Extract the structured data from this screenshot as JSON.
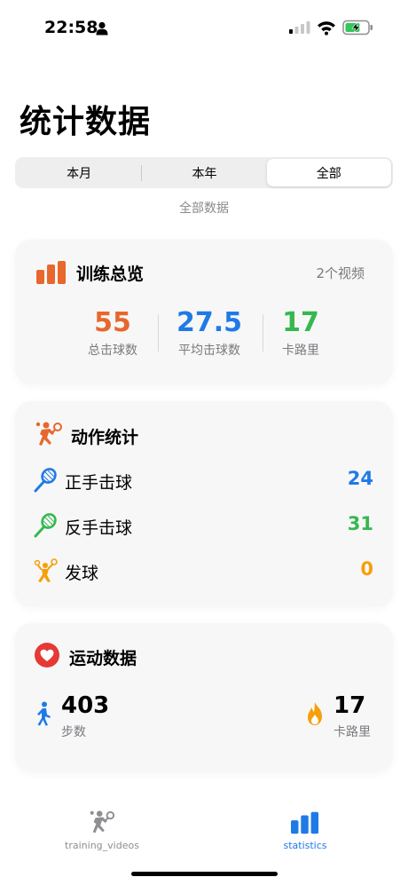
{
  "status_bar": {
    "time": "22:58"
  },
  "page": {
    "title": "统计数据"
  },
  "filter": {
    "segments": [
      "本月",
      "本年",
      "全部"
    ],
    "selected_index": 2,
    "caption": "全部数据"
  },
  "overview": {
    "title": "训练总览",
    "video_count": "2个视频",
    "metrics": [
      {
        "value": "55",
        "label": "总击球数",
        "color": "#e8672c"
      },
      {
        "value": "27.5",
        "label": "平均击球数",
        "color": "#1f7ae6"
      },
      {
        "value": "17",
        "label": "卡路里",
        "color": "#35b84e"
      }
    ]
  },
  "actions": {
    "title": "动作统计",
    "rows": [
      {
        "label": "正手击球",
        "value": "24",
        "color": "#1f7ae6",
        "icon": "tennis-racket-blue-icon"
      },
      {
        "label": "反手击球",
        "value": "31",
        "color": "#35b84e",
        "icon": "tennis-racket-green-icon"
      },
      {
        "label": "发球",
        "value": "0",
        "color": "#f5a00a",
        "icon": "serve-player-icon"
      }
    ]
  },
  "sport": {
    "title": "运动数据",
    "steps": {
      "value": "403",
      "label": "步数"
    },
    "calories": {
      "value": "17",
      "label": "卡路里"
    }
  },
  "tabs": [
    {
      "label": "training_videos",
      "active": false
    },
    {
      "label": "statistics",
      "active": true
    }
  ],
  "colors": {
    "accent": "#1f7ae6",
    "orange": "#e8672c",
    "green": "#35b84e",
    "yellow": "#f5a00a",
    "red": "#e53935"
  }
}
